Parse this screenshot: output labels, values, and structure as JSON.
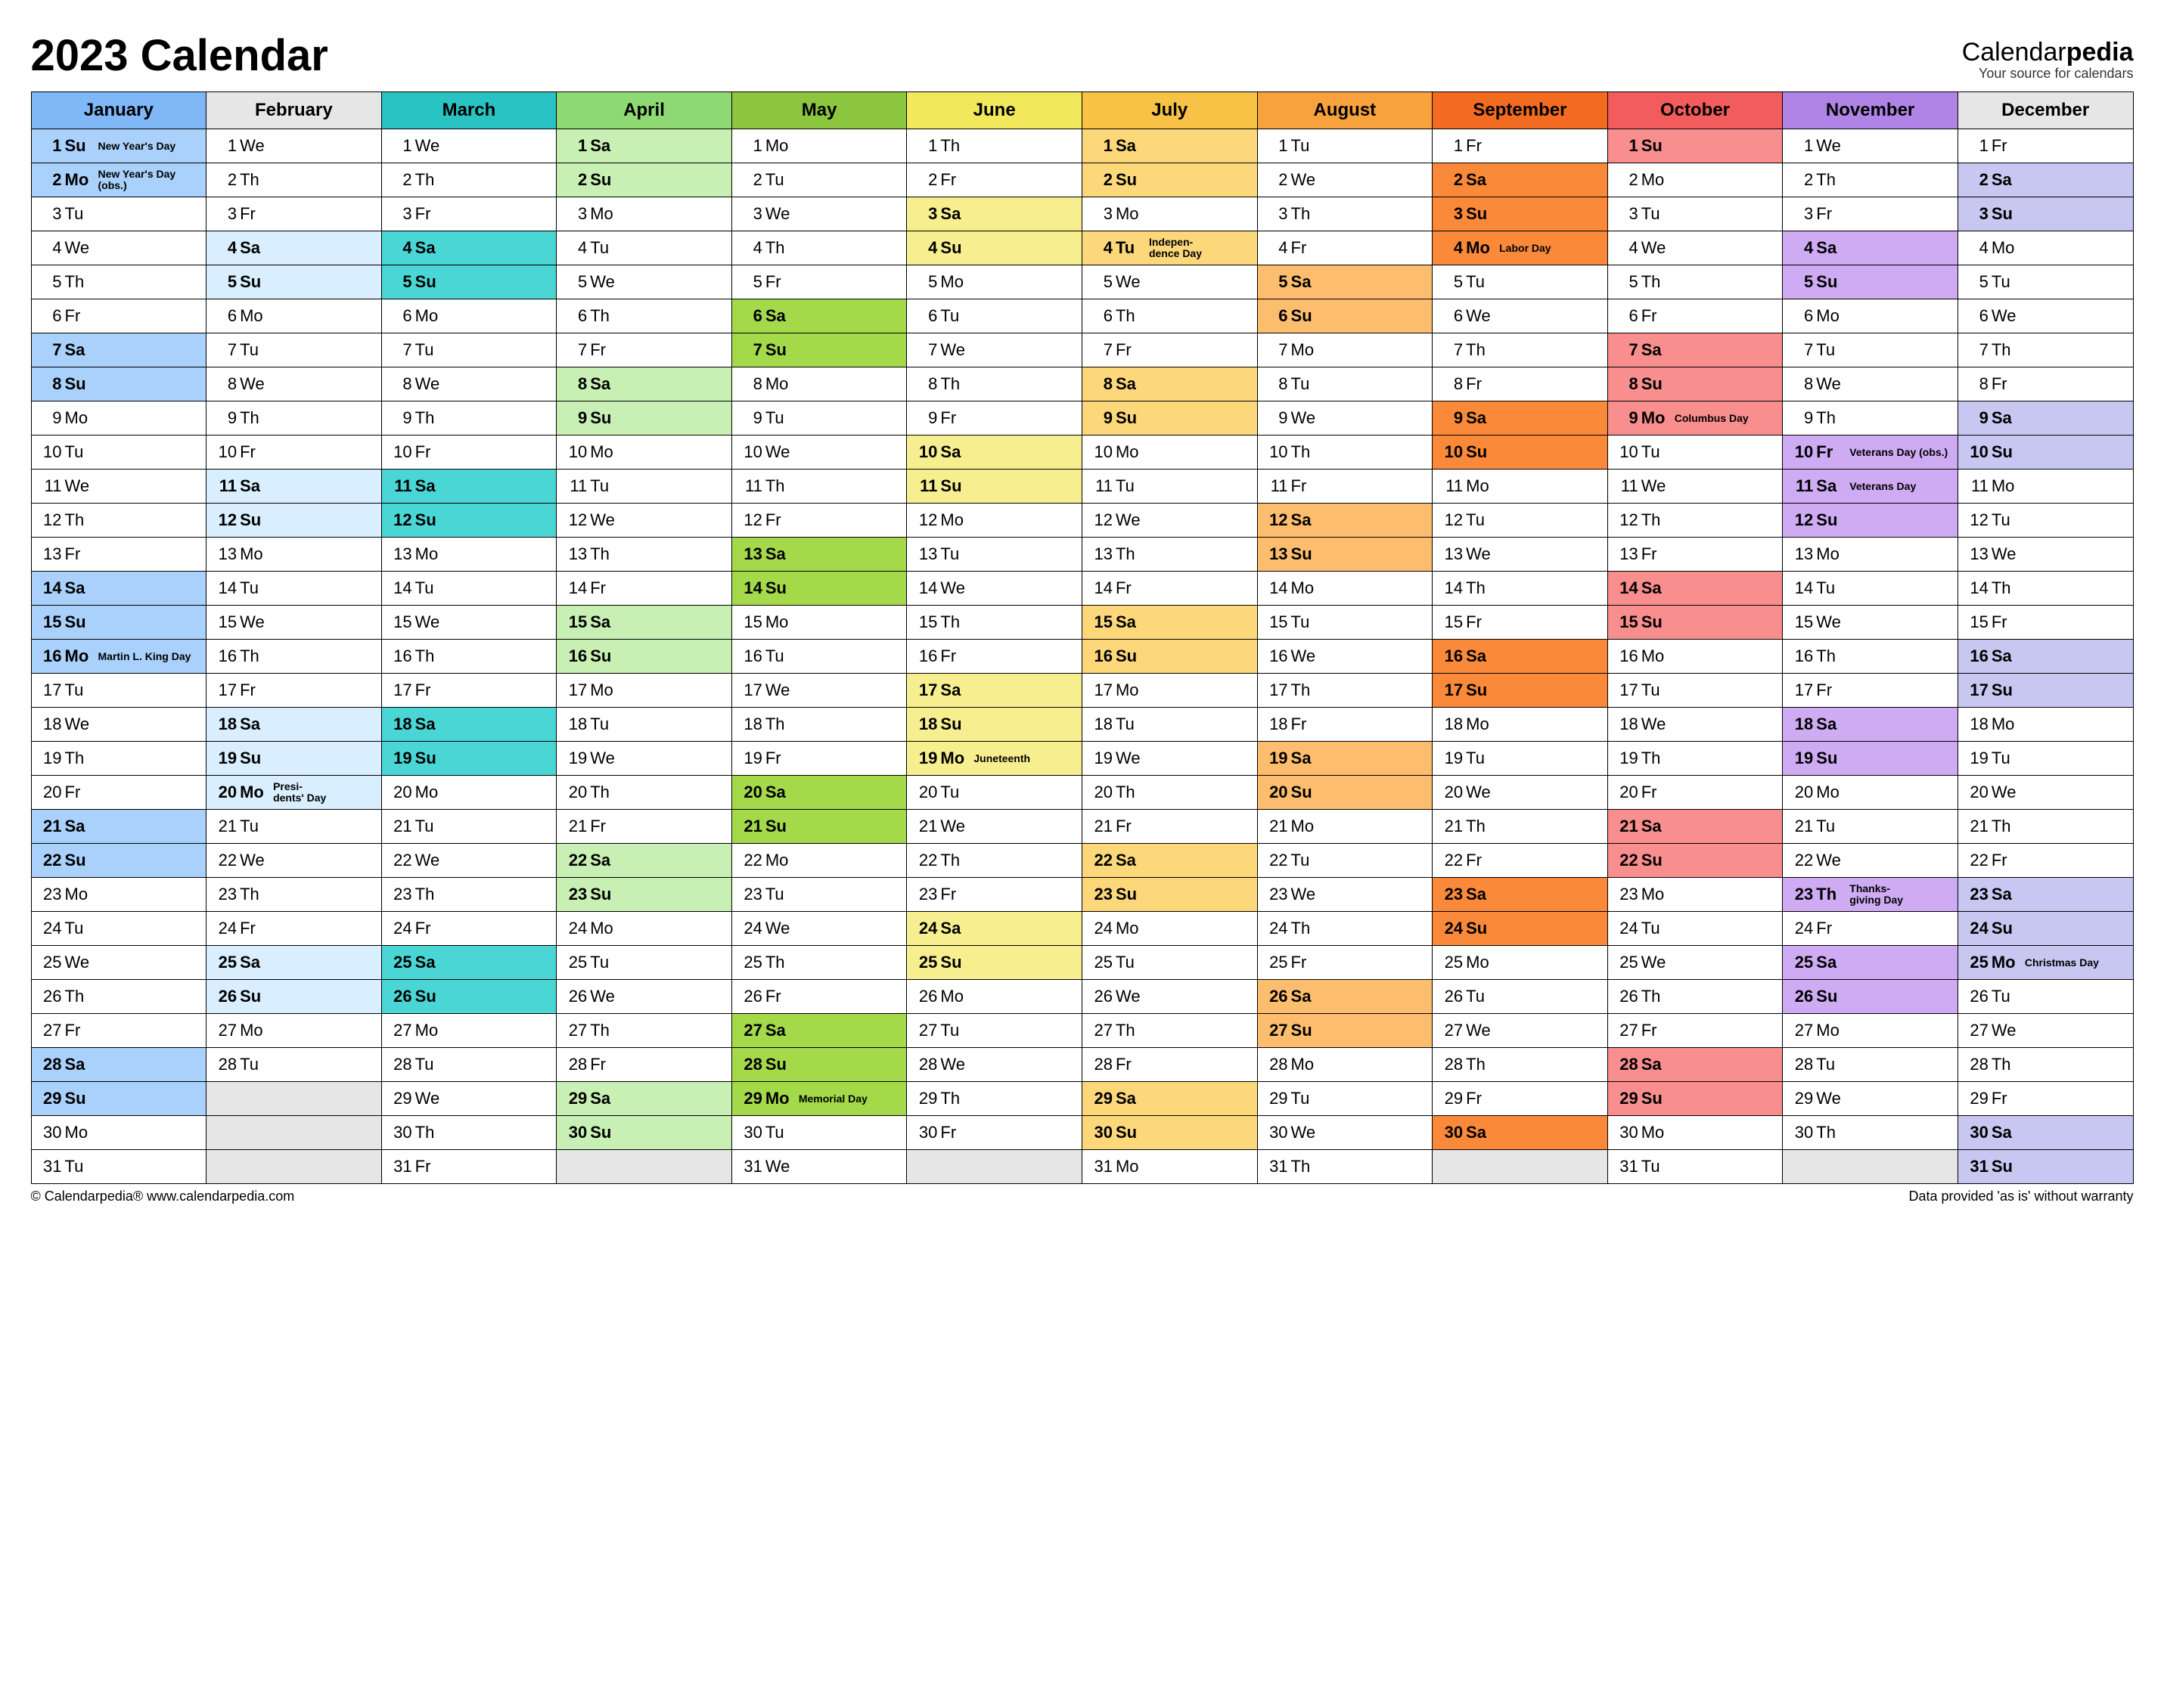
{
  "title": "2023 Calendar",
  "brand": {
    "name_a": "Calendar",
    "name_b": "pedia",
    "tagline": "Your source for calendars"
  },
  "footer": {
    "left": "© Calendarpedia®   www.calendarpedia.com",
    "right": "Data provided 'as is' without warranty"
  },
  "dow_short": [
    "Su",
    "Mo",
    "Tu",
    "We",
    "Th",
    "Fr",
    "Sa"
  ],
  "months": [
    {
      "name": "January",
      "first_dow": 0,
      "days": 31,
      "hcls": "m1h",
      "wcls": "m1w",
      "events": {
        "1": "New Year's Day",
        "2": "New Year's Day (obs.)",
        "16": "Martin L. King Day"
      }
    },
    {
      "name": "February",
      "first_dow": 3,
      "days": 28,
      "hcls": "m2h",
      "wcls": "m2w",
      "events": {
        "20": "Presi-\ndents' Day"
      }
    },
    {
      "name": "March",
      "first_dow": 3,
      "days": 31,
      "hcls": "m3h",
      "wcls": "m3w",
      "events": {}
    },
    {
      "name": "April",
      "first_dow": 6,
      "days": 30,
      "hcls": "m4h",
      "wcls": "m4w",
      "events": {}
    },
    {
      "name": "May",
      "first_dow": 1,
      "days": 31,
      "hcls": "m5h",
      "wcls": "m5w",
      "events": {
        "29": "Memorial Day"
      }
    },
    {
      "name": "June",
      "first_dow": 4,
      "days": 30,
      "hcls": "m6h",
      "wcls": "m6w",
      "events": {
        "19": "Juneteenth"
      }
    },
    {
      "name": "July",
      "first_dow": 6,
      "days": 31,
      "hcls": "m7h",
      "wcls": "m7w",
      "events": {
        "4": "Indepen-\ndence Day"
      }
    },
    {
      "name": "August",
      "first_dow": 2,
      "days": 31,
      "hcls": "m8h",
      "wcls": "m8w",
      "events": {}
    },
    {
      "name": "September",
      "first_dow": 5,
      "days": 30,
      "hcls": "m9h",
      "wcls": "m9w",
      "events": {
        "4": "Labor Day"
      }
    },
    {
      "name": "October",
      "first_dow": 0,
      "days": 31,
      "hcls": "m10h",
      "wcls": "m10w",
      "events": {
        "9": "Columbus Day"
      }
    },
    {
      "name": "November",
      "first_dow": 3,
      "days": 30,
      "hcls": "m11h",
      "wcls": "m11w",
      "events": {
        "10": "Veterans Day (obs.)",
        "11": "Veterans Day",
        "23": "Thanks-\ngiving Day"
      }
    },
    {
      "name": "December",
      "first_dow": 5,
      "days": 31,
      "hcls": "m12h",
      "wcls": "m12w",
      "events": {
        "25": "Christmas Day"
      }
    }
  ]
}
